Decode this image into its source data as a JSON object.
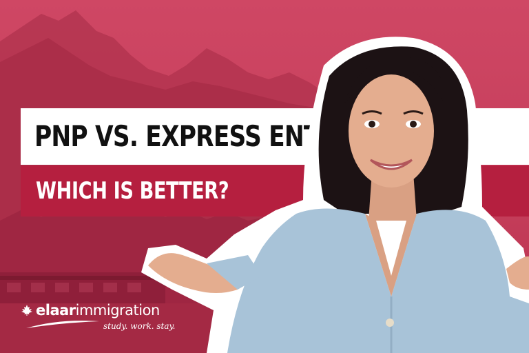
{
  "headline": {
    "title": "PNP VS. EXPRESS ENTRY",
    "subtitle": "WHICH IS BETTER?"
  },
  "brand": {
    "name_bold": "elaar",
    "name_regular": "immigration",
    "tagline": "study. work. stay."
  },
  "colors": {
    "background": "#c43a57",
    "title_band": "#ffffff",
    "subtitle_band": "#b51f3f",
    "title_text": "#111111",
    "subtitle_text": "#ffffff"
  },
  "icons": [
    "maple-leaf-icon"
  ]
}
